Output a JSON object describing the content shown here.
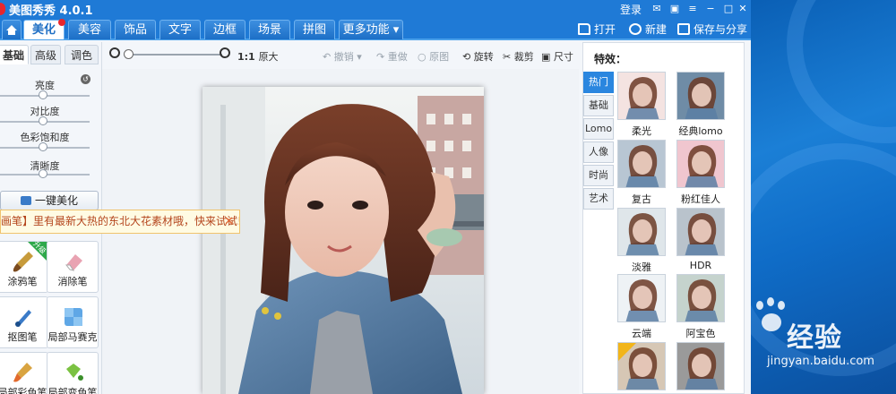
{
  "titlebar": {
    "title": "美图秀秀 4.0.1",
    "login_label": "登录"
  },
  "menu": {
    "tabs": [
      {
        "label": "美化",
        "active": true
      },
      {
        "label": "美容",
        "active": false
      },
      {
        "label": "饰品",
        "active": false
      },
      {
        "label": "文字",
        "active": false
      },
      {
        "label": "边框",
        "active": false
      },
      {
        "label": "场景",
        "active": false
      },
      {
        "label": "拼图",
        "active": false
      },
      {
        "label": "更多功能 ▾",
        "active": false
      }
    ],
    "open_label": "打开",
    "new_label": "新建",
    "save_label": "保存与分享"
  },
  "left": {
    "subtabs": [
      {
        "label": "基础",
        "active": true
      },
      {
        "label": "高级",
        "active": false
      },
      {
        "label": "调色",
        "active": false
      }
    ],
    "sliders": [
      {
        "label": "亮度",
        "level": 0.48
      },
      {
        "label": "对比度",
        "level": 0.48
      },
      {
        "label": "色彩饱和度",
        "level": 0.48
      },
      {
        "label": "清晰度",
        "level": 0.48
      }
    ],
    "one_key_label": "一键美化",
    "tip_text": "画笔】里有最新大热的东北大花素材哦，快来试试!",
    "tools": [
      {
        "label": "涂鸦笔",
        "badge": "升级"
      },
      {
        "label": "消除笔",
        "badge": ""
      },
      {
        "label": "抠图笔",
        "badge": ""
      },
      {
        "label": "局部马赛克",
        "badge": ""
      },
      {
        "label": "局部彩色笔",
        "badge": ""
      },
      {
        "label": "局部变色笔",
        "badge": ""
      }
    ]
  },
  "toolbar": {
    "ratio_label": "1:1",
    "original_size_label": "原大",
    "undo_label": "撤销",
    "redo_label": "重做",
    "original_label": "原图",
    "rotate_label": "旋转",
    "crop_label": "裁剪",
    "size_label": "尺寸"
  },
  "effects": {
    "header": "特效：",
    "categories": [
      {
        "label": "热门",
        "active": true
      },
      {
        "label": "基础",
        "active": false
      },
      {
        "label": "Lomo",
        "active": false
      },
      {
        "label": "人像",
        "active": false
      },
      {
        "label": "时尚",
        "active": false
      },
      {
        "label": "艺术",
        "active": false
      }
    ],
    "items": [
      {
        "label": "柔光",
        "tint": "#f4e3e1"
      },
      {
        "label": "经典lomo",
        "tint": "#6f8ca6"
      },
      {
        "label": "复古",
        "tint": "#b8c6d3"
      },
      {
        "label": "粉红佳人",
        "tint": "#f0c6cf"
      },
      {
        "label": "淡雅",
        "tint": "#dfe6ea"
      },
      {
        "label": "HDR",
        "tint": "#b9c3cc"
      },
      {
        "label": "云端",
        "tint": "#eef2f5"
      },
      {
        "label": "阿宝色",
        "tint": "#c5d3cd"
      },
      {
        "label": "",
        "tint": "#d6c7b5"
      },
      {
        "label": "",
        "tint": "#9a9a9a"
      }
    ]
  },
  "watermark": {
    "brand": "经验",
    "url": "jingyan.baidu.com"
  },
  "colors": {
    "titlebar": "#1f7ad6",
    "active_category": "#2a86df",
    "tip_text": "#b4451d"
  }
}
